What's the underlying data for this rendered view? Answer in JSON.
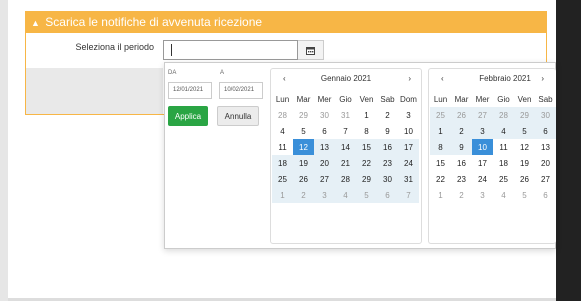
{
  "panel": {
    "title": "Scarica le notifiche di avvenuta ricezione"
  },
  "form": {
    "period_label": "Seleziona il periodo",
    "period_value": ""
  },
  "colors": {
    "header": "#f7b646",
    "apply": "#2aa544",
    "selected": "#3a8fd9",
    "range": "#e6f0f6"
  },
  "picker": {
    "from_label": "DA",
    "from_value": "12/01/2021",
    "to_label": "A",
    "to_value": "10/02/2021",
    "apply_label": "Applica",
    "cancel_label": "Annulla",
    "prev_icon": "‹",
    "next_icon": "›",
    "weekdays": [
      "Lun",
      "Mar",
      "Mer",
      "Gio",
      "Ven",
      "Sab",
      "Dom"
    ],
    "calendars": [
      {
        "month": "Gennaio 2021",
        "weeks": [
          [
            {
              "d": "28",
              "s": "off"
            },
            {
              "d": "29",
              "s": "off"
            },
            {
              "d": "30",
              "s": "off"
            },
            {
              "d": "31",
              "s": "off"
            },
            {
              "d": "1"
            },
            {
              "d": "2"
            },
            {
              "d": "3"
            }
          ],
          [
            {
              "d": "4"
            },
            {
              "d": "5"
            },
            {
              "d": "6"
            },
            {
              "d": "7"
            },
            {
              "d": "8"
            },
            {
              "d": "9"
            },
            {
              "d": "10"
            }
          ],
          [
            {
              "d": "11"
            },
            {
              "d": "12",
              "s": "sel"
            },
            {
              "d": "13",
              "s": "rng"
            },
            {
              "d": "14",
              "s": "rng"
            },
            {
              "d": "15",
              "s": "rng"
            },
            {
              "d": "16",
              "s": "rng"
            },
            {
              "d": "17",
              "s": "rng"
            }
          ],
          [
            {
              "d": "18",
              "s": "rng"
            },
            {
              "d": "19",
              "s": "rng"
            },
            {
              "d": "20",
              "s": "rng"
            },
            {
              "d": "21",
              "s": "rng"
            },
            {
              "d": "22",
              "s": "rng"
            },
            {
              "d": "23",
              "s": "rng"
            },
            {
              "d": "24",
              "s": "rng"
            }
          ],
          [
            {
              "d": "25",
              "s": "rng"
            },
            {
              "d": "26",
              "s": "rng"
            },
            {
              "d": "27",
              "s": "rng"
            },
            {
              "d": "28",
              "s": "rng"
            },
            {
              "d": "29",
              "s": "rng"
            },
            {
              "d": "30",
              "s": "rng"
            },
            {
              "d": "31",
              "s": "rng"
            }
          ],
          [
            {
              "d": "1",
              "s": "off rng"
            },
            {
              "d": "2",
              "s": "off rng"
            },
            {
              "d": "3",
              "s": "off rng"
            },
            {
              "d": "4",
              "s": "off rng"
            },
            {
              "d": "5",
              "s": "off rng"
            },
            {
              "d": "6",
              "s": "off rng"
            },
            {
              "d": "7",
              "s": "off rng"
            }
          ]
        ]
      },
      {
        "month": "Febbraio 2021",
        "weeks": [
          [
            {
              "d": "25",
              "s": "off rng"
            },
            {
              "d": "26",
              "s": "off rng"
            },
            {
              "d": "27",
              "s": "off rng"
            },
            {
              "d": "28",
              "s": "off rng"
            },
            {
              "d": "29",
              "s": "off rng"
            },
            {
              "d": "30",
              "s": "off rng"
            },
            {
              "d": "31",
              "s": "off rng"
            }
          ],
          [
            {
              "d": "1",
              "s": "rng"
            },
            {
              "d": "2",
              "s": "rng"
            },
            {
              "d": "3",
              "s": "rng"
            },
            {
              "d": "4",
              "s": "rng"
            },
            {
              "d": "5",
              "s": "rng"
            },
            {
              "d": "6",
              "s": "rng"
            },
            {
              "d": "7",
              "s": "rng"
            }
          ],
          [
            {
              "d": "8",
              "s": "rng"
            },
            {
              "d": "9",
              "s": "rng"
            },
            {
              "d": "10",
              "s": "sel"
            },
            {
              "d": "11"
            },
            {
              "d": "12"
            },
            {
              "d": "13"
            },
            {
              "d": "14"
            }
          ],
          [
            {
              "d": "15"
            },
            {
              "d": "16"
            },
            {
              "d": "17"
            },
            {
              "d": "18"
            },
            {
              "d": "19"
            },
            {
              "d": "20"
            },
            {
              "d": "21"
            }
          ],
          [
            {
              "d": "22"
            },
            {
              "d": "23"
            },
            {
              "d": "24"
            },
            {
              "d": "25"
            },
            {
              "d": "26"
            },
            {
              "d": "27"
            },
            {
              "d": "28"
            }
          ],
          [
            {
              "d": "1",
              "s": "off"
            },
            {
              "d": "2",
              "s": "off"
            },
            {
              "d": "3",
              "s": "off"
            },
            {
              "d": "4",
              "s": "off"
            },
            {
              "d": "5",
              "s": "off"
            },
            {
              "d": "6",
              "s": "off"
            },
            {
              "d": "7",
              "s": "off"
            }
          ]
        ]
      }
    ]
  }
}
